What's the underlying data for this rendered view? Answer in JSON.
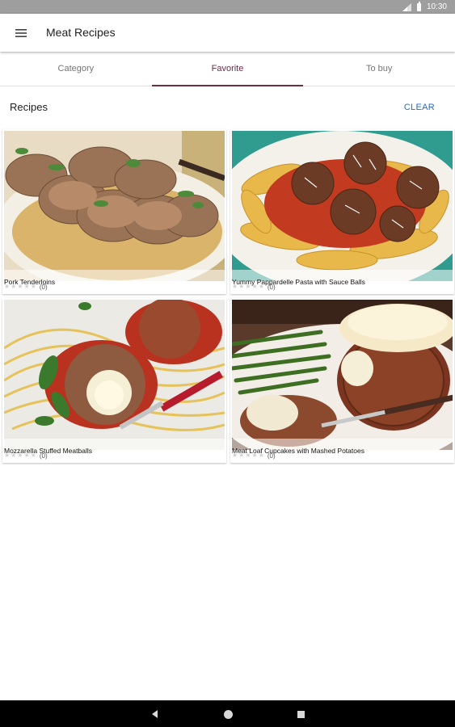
{
  "status": {
    "time": "10:30"
  },
  "appbar": {
    "title": "Meat Recipes"
  },
  "tabs": [
    {
      "label": "Category",
      "active": false
    },
    {
      "label": "Favorite",
      "active": true
    },
    {
      "label": "To buy",
      "active": false
    }
  ],
  "section": {
    "title": "Recipes",
    "clear_label": "CLEAR"
  },
  "recipes": [
    {
      "title": "Pork Tenderloins",
      "rating_count": "(0)",
      "stars": 0
    },
    {
      "title": "Yummy Pappardelle Pasta with Sauce Balls",
      "rating_count": "(0)",
      "stars": 0
    },
    {
      "title": "Mozzarella Stuffed Meatballs",
      "rating_count": "(0)",
      "stars": 0
    },
    {
      "title": "Meat Loaf Cupcakes with Mashed Potatoes",
      "rating_count": "(0)",
      "stars": 0
    }
  ],
  "colors": {
    "accent": "#6d2d45",
    "link": "#1e6fbf",
    "statusbar": "#9e9e9e"
  },
  "icons": [
    "menu-icon",
    "signal-icon",
    "battery-icon",
    "star-icon",
    "back-icon",
    "home-icon",
    "recents-icon"
  ]
}
